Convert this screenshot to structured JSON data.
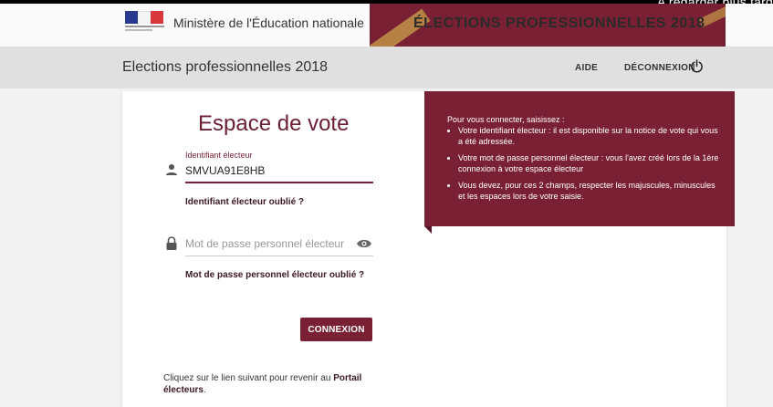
{
  "overlay": {
    "text": "A regarder plus tard"
  },
  "header": {
    "ministry": "Ministère de l'Éducation nationale",
    "banner_title": "ÉLECTIONS PROFESSIONNELLES 2018"
  },
  "appbar": {
    "title": "Elections professionnelles 2018",
    "help": "AIDE",
    "logout": "DÉCONNEXION"
  },
  "form": {
    "title": "Espace de vote",
    "id_label": "Identifiant électeur",
    "id_value": "SMVUA91E8HB",
    "forgot_id": "Identifiant électeur oublié ?",
    "password_placeholder": "Mot de passe personnel électeur",
    "forgot_password": "Mot de passe personnel électeur oublié ?",
    "connect_label": "CONNEXION",
    "footer_text": "Cliquez sur le lien suivant pour revenir au",
    "footer_link": "Portail électeurs",
    "footer_end": "."
  },
  "info": {
    "intro": "Pour vous connecter, saisissez :",
    "items": [
      "Votre identifiant électeur : il est disponible sur la notice de vote qui vous a été adressée.",
      "Votre mot de passe personnel électeur : vous l'avez créé lors de la 1ère connexion à votre espace électeur",
      "Vous devez, pour ces 2 champs, respecter les majuscules, minuscules et les espaces lors de votre saisie."
    ]
  },
  "colors": {
    "brand": "#7a2035",
    "app_bar": "#e0e0e0"
  },
  "icons": {
    "user": "user-icon",
    "lock": "lock-icon",
    "eye": "eye-icon",
    "power": "power-icon"
  }
}
